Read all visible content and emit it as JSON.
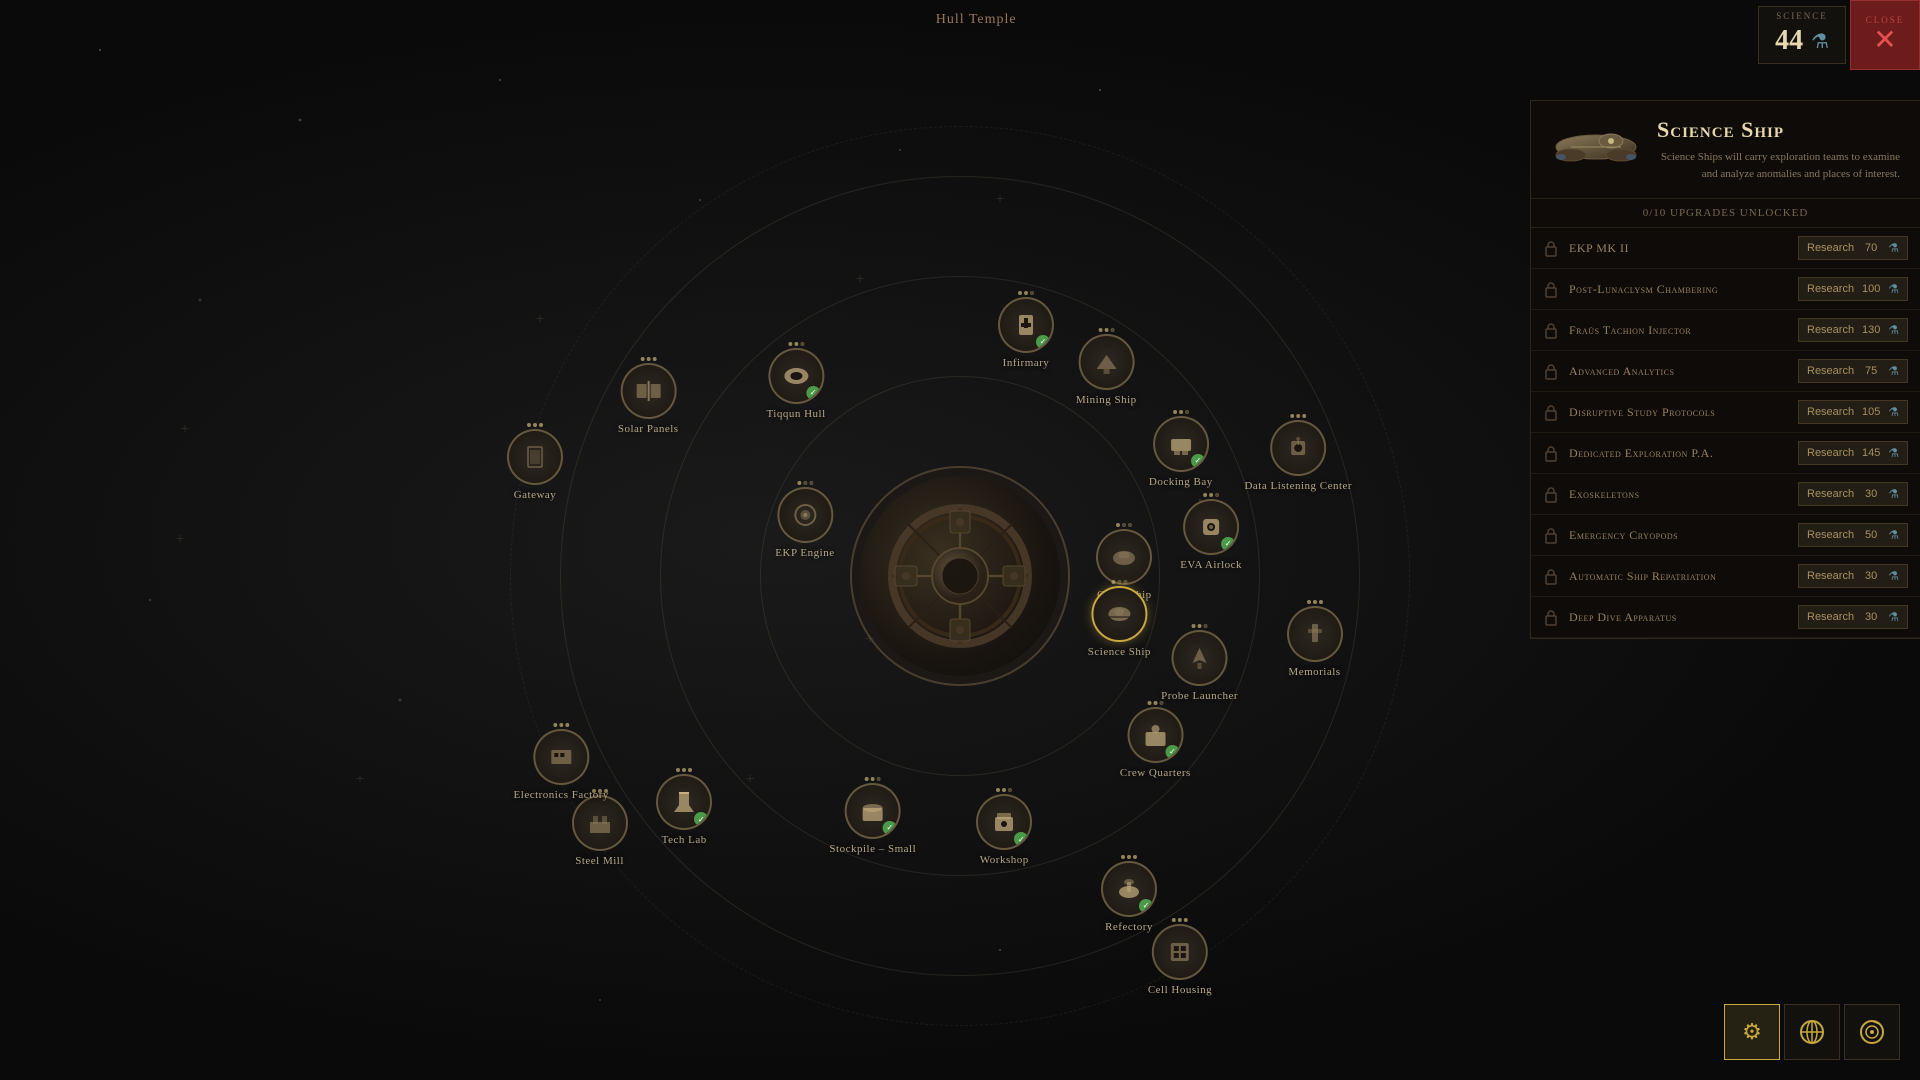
{
  "topbar": {
    "science_label": "SCIENCE",
    "science_value": "44",
    "close_label": "CLOSE"
  },
  "main_title": "Hull Temple",
  "sidebar": {
    "title": "Science Ship",
    "description": "Science Ships will carry exploration teams to examine and analyze anomalies and places of interest.",
    "upgrades_header": "0/10 UPGRADES UNLOCKED",
    "upgrades": [
      {
        "name": "EKP MK II",
        "research": "Research",
        "cost": 70
      },
      {
        "name": "Post-Lunaclysm Chambering",
        "research": "Research",
        "cost": 100
      },
      {
        "name": "Fraüs Tachion Injector",
        "research": "Research",
        "cost": 130
      },
      {
        "name": "Advanced Analytics",
        "research": "Research",
        "cost": 75
      },
      {
        "name": "Disruptive Study Protocols",
        "research": "Research",
        "cost": 105
      },
      {
        "name": "Dedicated Exploration P.A.",
        "research": "Research",
        "cost": 145
      },
      {
        "name": "Exoskeletons",
        "research": "Research",
        "cost": 30
      },
      {
        "name": "Emergency Cryopods",
        "research": "Research",
        "cost": 50
      },
      {
        "name": "Automatic Ship Repatriation",
        "research": "Research",
        "cost": 30
      },
      {
        "name": "Deep Dive Apparatus",
        "research": "Research",
        "cost": 30
      }
    ]
  },
  "nodes": [
    {
      "id": "infirmary",
      "label": "Infirmary",
      "checked": true,
      "ring": 2,
      "angle": -75
    },
    {
      "id": "docking-bay",
      "label": "Docking Bay",
      "checked": true,
      "ring": 2,
      "angle": -30
    },
    {
      "id": "solar-panels",
      "label": "Solar Panels",
      "checked": false,
      "ring": 3,
      "angle": -150
    },
    {
      "id": "tiqqun-hull",
      "label": "Tiqqun Hull",
      "checked": true,
      "ring": 2,
      "angle": -130
    },
    {
      "id": "mining-ship",
      "label": "Mining Ship",
      "checked": false,
      "ring": 2,
      "angle": -55
    },
    {
      "id": "ekp-engine",
      "label": "EKP Engine",
      "checked": false,
      "ring": 1,
      "angle": -160
    },
    {
      "id": "eva-airlock",
      "label": "EVA Airlock",
      "checked": true,
      "ring": 2,
      "angle": -10
    },
    {
      "id": "cargo-ship",
      "label": "Cargo Ship",
      "checked": false,
      "ring": 1,
      "angle": -5
    },
    {
      "id": "science-ship",
      "label": "Science Ship",
      "checked": false,
      "ring": 1,
      "angle": 15,
      "selected": true
    },
    {
      "id": "data-listening",
      "label": "Data Listening Center",
      "checked": false,
      "ring": 3,
      "angle": -20
    },
    {
      "id": "probe-launcher",
      "label": "Probe Launcher",
      "checked": false,
      "ring": 2,
      "angle": 20
    },
    {
      "id": "memorials",
      "label": "Memorials",
      "checked": false,
      "ring": 3,
      "angle": 10
    },
    {
      "id": "tech-lab",
      "label": "Tech Lab",
      "checked": true,
      "ring": 3,
      "angle": 140
    },
    {
      "id": "stockpile-small",
      "label": "Stockpile – Small",
      "checked": true,
      "ring": 2,
      "angle": 110
    },
    {
      "id": "workshop",
      "label": "Workshop",
      "checked": true,
      "ring": 2,
      "angle": 80
    },
    {
      "id": "crew-quarters",
      "label": "Crew Quarters",
      "checked": true,
      "ring": 2,
      "angle": 40
    },
    {
      "id": "refectory",
      "label": "Refectory",
      "checked": true,
      "ring": 3,
      "angle": 62
    },
    {
      "id": "gateway",
      "label": "Gateway",
      "checked": false,
      "ring": 4,
      "angle": -165
    },
    {
      "id": "steel-mill",
      "label": "Steel Mill",
      "checked": false,
      "ring": 4,
      "angle": 145
    },
    {
      "id": "electronics-factory",
      "label": "Electronics Factory",
      "checked": false,
      "ring": 4,
      "angle": 155
    },
    {
      "id": "cell-housing",
      "label": "Cell Housing",
      "checked": false,
      "ring": 4,
      "angle": 60
    }
  ],
  "bottom_buttons": [
    {
      "id": "settings",
      "icon": "⚙",
      "active": true
    },
    {
      "id": "globe",
      "icon": "🌐",
      "active": false
    },
    {
      "id": "radar",
      "icon": "◎",
      "active": false
    }
  ]
}
